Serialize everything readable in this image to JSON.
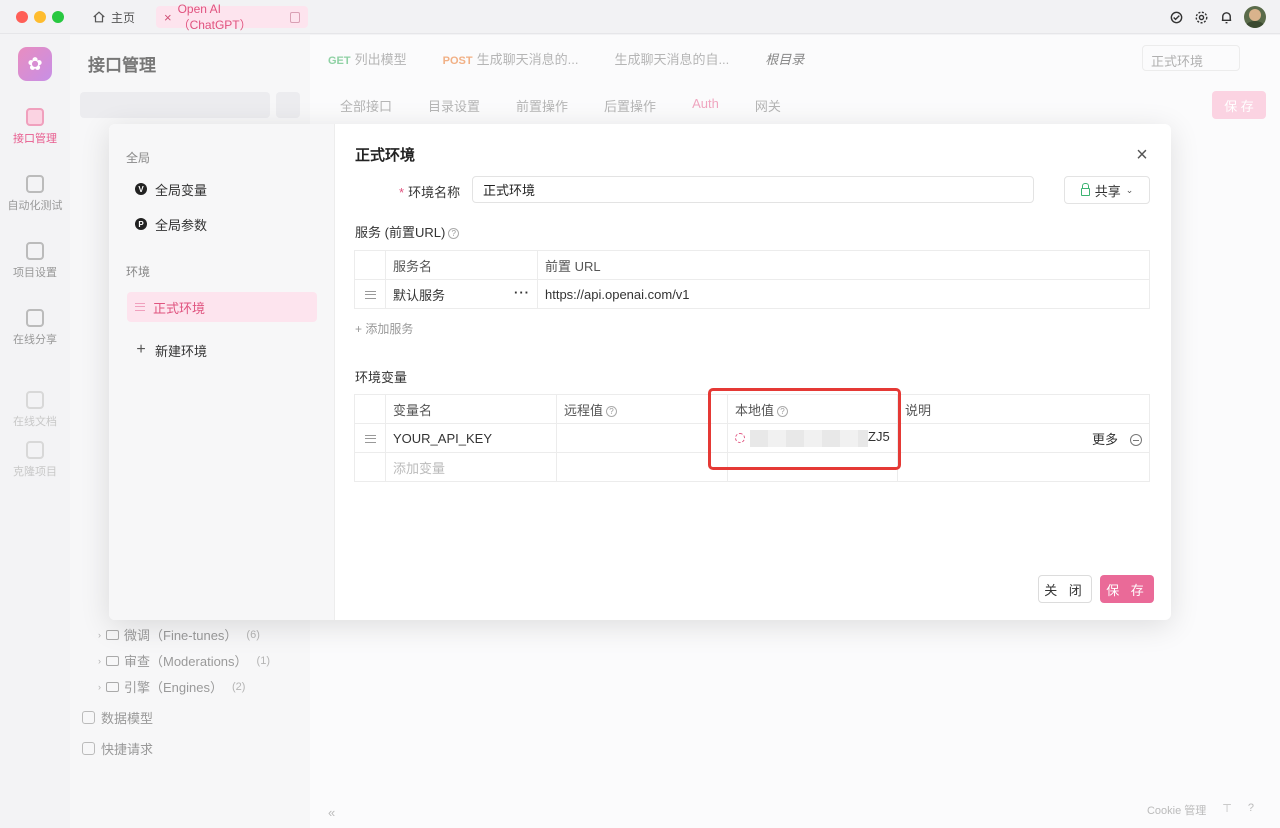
{
  "titlebar": {
    "home_label": "主页",
    "active_tab_label": "Open AI（ChatGPT）"
  },
  "nav": {
    "items": [
      {
        "label": "接口管理",
        "icon": "api-icon"
      },
      {
        "label": "自动化测试",
        "icon": "layers-icon"
      },
      {
        "label": "项目设置",
        "icon": "settings-icon"
      },
      {
        "label": "在线分享",
        "icon": "share-icon"
      },
      {
        "label": "在线文档",
        "icon": "book-icon"
      },
      {
        "label": "克隆项目",
        "icon": "copy-icon"
      }
    ]
  },
  "sidebar": {
    "title": "接口管理",
    "tree": [
      {
        "label": "微调（Fine-tunes）",
        "count": "(6)"
      },
      {
        "label": "审查（Moderations）",
        "count": "(1)"
      },
      {
        "label": "引擎（Engines）",
        "count": "(2)"
      }
    ],
    "data_model": "数据模型",
    "quick_request": "快捷请求"
  },
  "main": {
    "tabs": [
      {
        "method": "GET",
        "label": "列出模型"
      },
      {
        "method": "POST",
        "label": "生成聊天消息的..."
      },
      {
        "method": "",
        "label": "生成聊天消息的自..."
      },
      {
        "method": "",
        "label": "根目录"
      }
    ],
    "env_select": "正式环境",
    "subtabs": [
      "全部接口",
      "目录设置",
      "前置操作",
      "后置操作",
      "Auth",
      "网关"
    ],
    "save": "保 存",
    "cookie": "Cookie 管理"
  },
  "modal": {
    "side": {
      "global_heading": "全局",
      "global_vars": "全局变量",
      "global_params": "全局参数",
      "env_heading": "环境",
      "env_active": "正式环境",
      "new_env": "新建环境"
    },
    "title": "正式环境",
    "name_label": "环境名称",
    "name_value": "正式环境",
    "share_label": "共享",
    "services_title": "服务 (前置URL)",
    "services_table": {
      "headers": [
        "服务名",
        "前置 URL"
      ],
      "rows": [
        {
          "name": "默认服务",
          "url": "https://api.openai.com/v1"
        }
      ]
    },
    "add_service": "+ 添加服务",
    "vars_title": "环境变量",
    "vars_table": {
      "headers": [
        "变量名",
        "远程值",
        "本地值",
        "说明"
      ],
      "rows": [
        {
          "name": "YOUR_API_KEY",
          "remote": "",
          "local_suffix": "ZJ5",
          "desc": "",
          "more": "更多"
        }
      ],
      "add_placeholder": "添加变量"
    },
    "close_btn": "关 闭",
    "save_btn": "保 存"
  },
  "colors": {
    "accent": "#e0537f",
    "accent_bg": "#fde4ee",
    "highlight": "#e53935"
  }
}
